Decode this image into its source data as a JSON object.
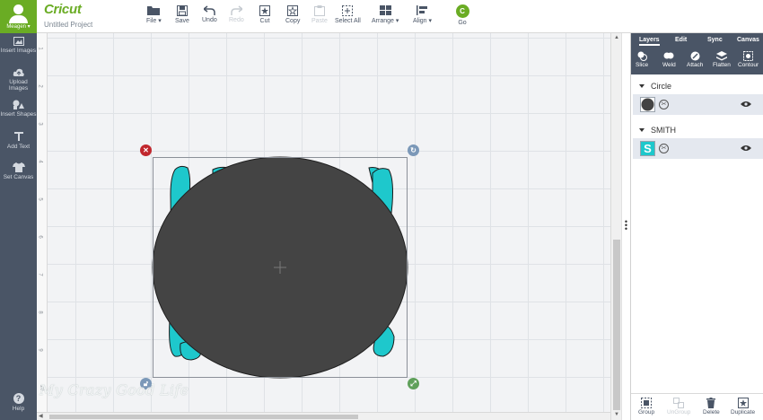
{
  "user": {
    "name": "Meagen ▾"
  },
  "brand": {
    "logo": "Cricut",
    "project_title": "Untitled Project",
    "accent": "#6aac24"
  },
  "leftnav": {
    "items": [
      {
        "label": "Insert Images",
        "icon": "image-icon"
      },
      {
        "label": "Upload Images",
        "icon": "upload-cloud-icon"
      },
      {
        "label": "Insert Shapes",
        "icon": "shapes-icon"
      },
      {
        "label": "Add Text",
        "icon": "text-icon"
      },
      {
        "label": "Set Canvas",
        "icon": "shirt-icon"
      }
    ],
    "help": "Help"
  },
  "toolbar": {
    "file": "File ▾",
    "save": "Save",
    "undo": "Undo",
    "redo": "Redo",
    "cut": "Cut",
    "copy": "Copy",
    "paste": "Paste",
    "select_all": "Select All",
    "arrange": "Arrange ▾",
    "align": "Align ▾",
    "go": "Go",
    "go_badge": "C"
  },
  "ruler": {
    "numbers": [
      "1",
      "2",
      "3",
      "4",
      "5",
      "6",
      "7",
      "8",
      "9",
      "10"
    ]
  },
  "canvas": {
    "watermark": "My Crazy Good Life",
    "circle_color": "#444444",
    "text_color": "#1ec8cc"
  },
  "panel": {
    "tabs": [
      "Layers",
      "Edit",
      "Sync",
      "Canvas"
    ],
    "tools": [
      "Slice",
      "Weld",
      "Attach",
      "Flatten",
      "Contour"
    ],
    "layers": [
      {
        "group": "Circle"
      },
      {
        "group": "SMITH",
        "thumb_letter": "S"
      }
    ],
    "bottom": {
      "group": "Group",
      "ungroup": "UnGroup",
      "delete": "Delete",
      "duplicate": "Duplicate"
    }
  }
}
